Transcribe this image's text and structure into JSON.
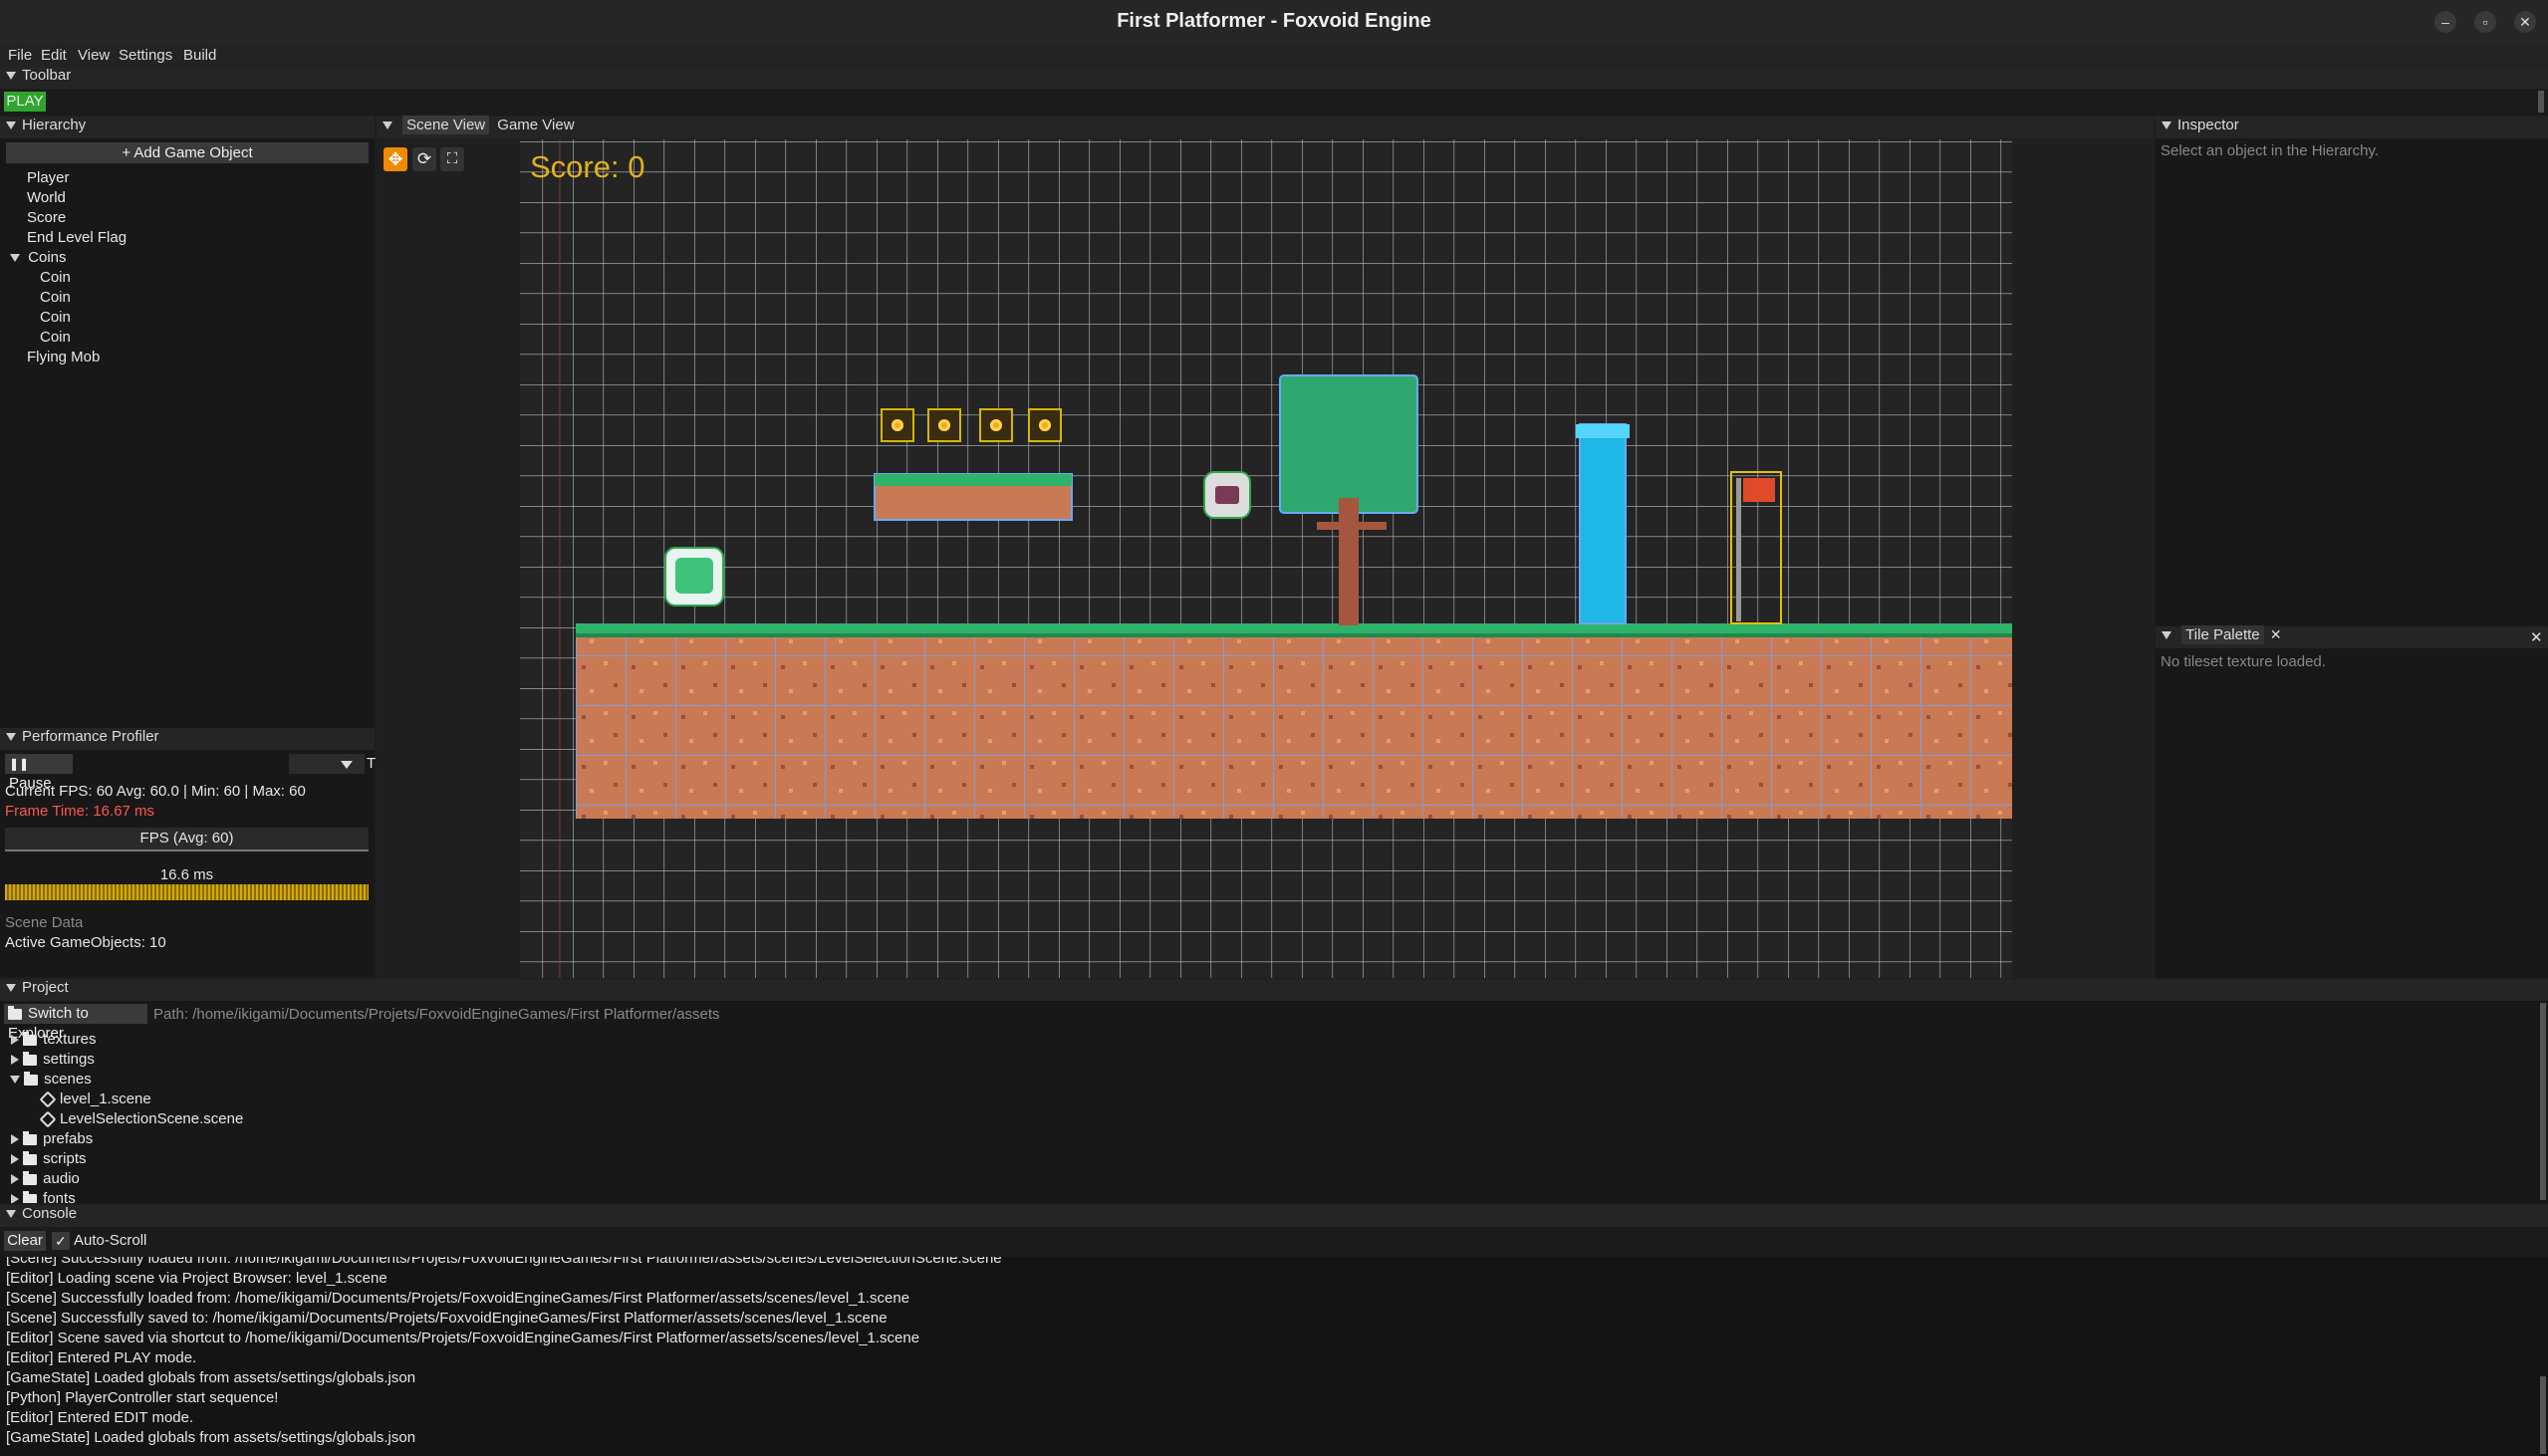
{
  "window": {
    "title": "First Platformer - Foxvoid Engine"
  },
  "menu": [
    "File",
    "Edit",
    "View",
    "Settings",
    "Build"
  ],
  "toolbar": {
    "header": "Toolbar",
    "play_label": "PLAY"
  },
  "hierarchy": {
    "header": "Hierarchy",
    "add_button": "+ Add Game Object",
    "items": [
      "Player",
      "World",
      "Score",
      "End Level Flag"
    ],
    "coins_group": "Coins",
    "coins": [
      "Coin",
      "Coin",
      "Coin",
      "Coin"
    ],
    "after": "Flying Mob"
  },
  "profiler": {
    "header": "Performance Profiler",
    "pause_label": "Pause",
    "dropdown_value": "T",
    "fps_line": "Current FPS: 60 Avg: 60.0 | Min: 60 | Max: 60",
    "frame_time": "Frame Time: 16.67 ms",
    "fps_bar_label": "FPS (Avg: 60)",
    "ms_bar_label": "16.6 ms",
    "scene_data_label": "Scene Data",
    "active_objects": "Active GameObjects: 10"
  },
  "scene_tabs": [
    "Scene View",
    "Game View"
  ],
  "scene": {
    "score_text": "Score: 0"
  },
  "inspector": {
    "header": "Inspector",
    "placeholder": "Select an object in the Hierarchy."
  },
  "tile_palette": {
    "header": "Tile Palette",
    "message": "No tileset texture loaded."
  },
  "project": {
    "header": "Project",
    "explorer_button": "Switch to Explorer",
    "path": "Path: /home/ikigami/Documents/Projets/FoxvoidEngineGames/First Platformer/assets",
    "folders": [
      "textures",
      "settings",
      "scenes"
    ],
    "scene_files": [
      "level_1.scene",
      "LevelSelectionScene.scene"
    ],
    "more_folders": [
      "prefabs",
      "scripts",
      "audio",
      "fonts"
    ]
  },
  "console": {
    "header": "Console",
    "clear_label": "Clear",
    "autoscroll_label": "Auto-Scroll",
    "lines": [
      "[Scene] Successfully loaded from: /home/ikigami/Documents/Projets/FoxvoidEngineGames/First Platformer/assets/scenes/LevelSelectionScene.scene",
      "[Editor] Loading scene via Project Browser: level_1.scene",
      "[Scene] Successfully loaded from: /home/ikigami/Documents/Projets/FoxvoidEngineGames/First Platformer/assets/scenes/level_1.scene",
      "[Scene] Successfully saved to: /home/ikigami/Documents/Projets/FoxvoidEngineGames/First Platformer/assets/scenes/level_1.scene",
      "[Editor] Scene saved via shortcut to /home/ikigami/Documents/Projets/FoxvoidEngineGames/First Platformer/assets/scenes/level_1.scene",
      "[Editor] Entered PLAY mode.",
      "[GameState] Loaded globals from assets/settings/globals.json",
      "[Python] PlayerController start sequence!",
      "[Editor] Entered EDIT mode.",
      "[GameState] Loaded globals from assets/settings/globals.json"
    ]
  },
  "colors": {
    "accent_green": "#2fa52f",
    "score_yellow": "#e0b21c",
    "frame_time_red": "#ff5555",
    "grass": "#2fb36a",
    "dirt": "#c87a55"
  }
}
